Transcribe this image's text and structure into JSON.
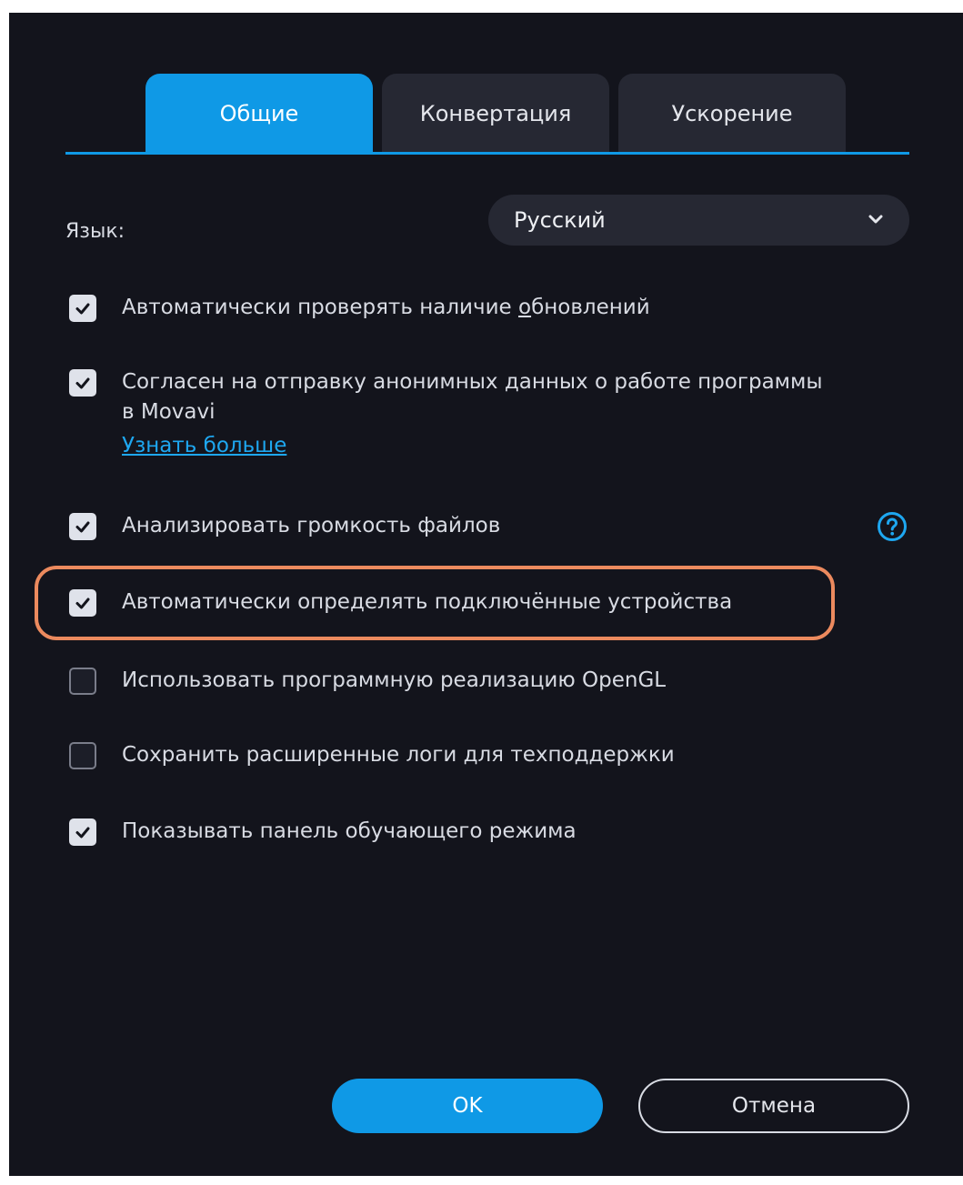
{
  "tabs": [
    {
      "label": "Общие",
      "active": true
    },
    {
      "label": "Конвертация",
      "active": false
    },
    {
      "label": "Ускорение",
      "active": false
    }
  ],
  "language": {
    "label": "Язык:",
    "selected": "Русский",
    "icon": "chevron-down-icon"
  },
  "options": [
    {
      "pre": "Автоматически проверять наличие ",
      "u": "о",
      "post": "бновлений",
      "checked": true
    },
    {
      "line1": "Согласен на отправку анонимных данных о работе программы",
      "line2": "в Movavi",
      "checked": true
    },
    {
      "label": "Анализировать громкость файлов",
      "checked": true
    },
    {
      "label": "Автоматически определять подключённые устройства",
      "checked": true
    },
    {
      "label": "Использовать программную реализацию OpenGL",
      "checked": false
    },
    {
      "label": "Сохранить расширенные логи для техподдержки",
      "checked": false
    },
    {
      "label": "Показывать панель обучающего режима",
      "checked": true
    }
  ],
  "learn_more": "Узнать больше",
  "help_icon": "question-circle-icon",
  "buttons": {
    "ok": "OK",
    "cancel": "Отмена"
  },
  "colors": {
    "accent": "#0f99e6",
    "background": "#13141c",
    "highlight": "#ec8a5e"
  }
}
